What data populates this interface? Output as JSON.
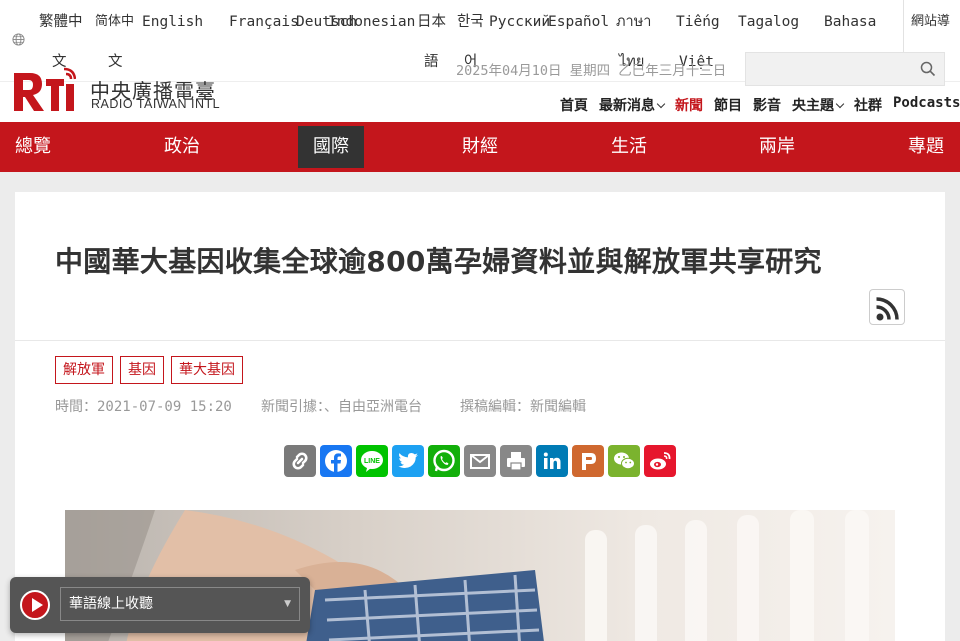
{
  "languages": {
    "trad_chinese": [
      "繁體中",
      "文"
    ],
    "simp_chinese": [
      "简体中",
      "文"
    ],
    "english": "English",
    "french": "Français",
    "german": "Deutsch",
    "indonesian": "Indonesian",
    "japanese": [
      "日本",
      "語"
    ],
    "korean": [
      "한국",
      "어"
    ],
    "russian": "Русский",
    "spanish": "Español",
    "thai": [
      "ภาษา",
      "ไทย"
    ],
    "vietnamese": [
      "Tiếng",
      "Việt"
    ],
    "tagalog": "Tagalog",
    "bahasa": "Bahasa",
    "sitemap": "網站導"
  },
  "date_line": "2025年04月10日 星期四 乙巳年三月十三日",
  "search": {
    "value": "",
    "placeholder": ""
  },
  "logo": {
    "mark": "Rti",
    "chinese": "中央廣播電臺",
    "english": "RADIO TAIWAN INTL"
  },
  "subnav": {
    "home": "首頁",
    "latest": "最新消息",
    "news": "新聞",
    "programs": "節目",
    "video": "影音",
    "topics": "央主題",
    "community": "社群",
    "podcasts": "Podcasts"
  },
  "mainnav": [
    "總覽",
    "政治",
    "國際",
    "財經",
    "生活",
    "兩岸",
    "專題"
  ],
  "article": {
    "title": "中國華大基因收集全球逾800萬孕婦資料並與解放軍共享研究",
    "tags": [
      "解放軍",
      "基因",
      "華大基因"
    ],
    "time_label": "時間：",
    "time_value": "2021-07-09 15:20",
    "source": "新聞引據：、自由亞洲電台",
    "editor": "撰稿編輯：新聞編輯"
  },
  "share_icons": [
    "link-icon",
    "facebook-icon",
    "line-icon",
    "twitter-icon",
    "whatsapp-icon",
    "email-icon",
    "print-icon",
    "linkedin-icon",
    "plurk-icon",
    "wechat-icon",
    "weibo-icon"
  ],
  "player": {
    "channel": "華語線上收聽"
  },
  "colors": {
    "brand_red": "#c4161c",
    "nav_active": "#333333"
  }
}
